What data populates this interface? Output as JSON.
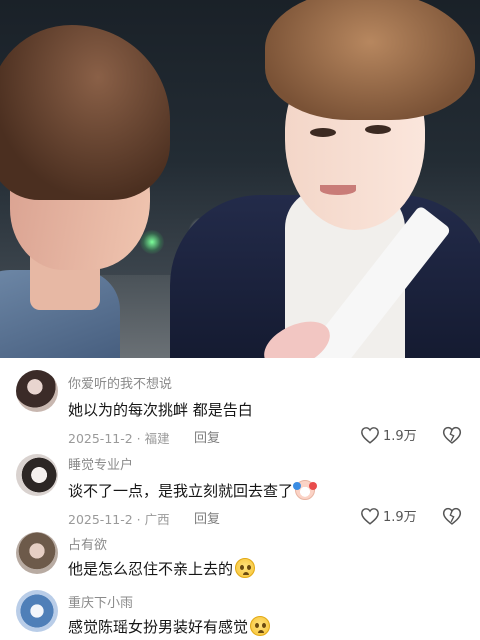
{
  "video": {
    "description_icon": "video-frame"
  },
  "comments": [
    {
      "username": "你爱听的我不想说",
      "text": "她以为的每次挑衅 都是告白",
      "emoji": "",
      "meta": "2025-11-2 · 福建",
      "reply": "回复",
      "likes": "1.9万"
    },
    {
      "username": "睡觉专业户",
      "text": "谈不了一点，是我立刻就回去查了",
      "emoji": "clown-face-emoji",
      "meta": "2025-11-2 · 广西",
      "reply": "回复",
      "likes": "1.9万"
    },
    {
      "username": "占有欲",
      "text": "他是怎么忍住不亲上去的",
      "emoji": "pleading-face-emoji"
    },
    {
      "username": "重庆下小雨",
      "text": "感觉陈瑶女扮男装好有感觉",
      "emoji": "pleading-face-emoji"
    }
  ],
  "colors": {
    "username": "#8a8a8a",
    "text": "#161616",
    "meta": "#9a9a9a"
  }
}
